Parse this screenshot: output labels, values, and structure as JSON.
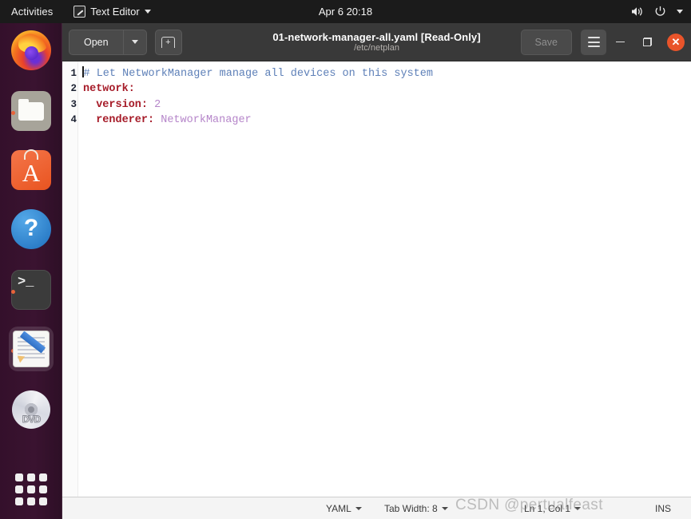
{
  "topbar": {
    "activities": "Activities",
    "app_menu": {
      "label": "Text Editor",
      "icon": "text-editor-icon",
      "arrow": "chevron-down-icon"
    },
    "clock": "Apr 6  20:18",
    "tray": [
      "volume-icon",
      "power-icon",
      "chevron-down-icon"
    ]
  },
  "dock": {
    "items": [
      {
        "name": "firefox",
        "label": "Firefox",
        "running": false,
        "active": false
      },
      {
        "name": "files",
        "label": "Files",
        "running": true,
        "active": false
      },
      {
        "name": "ubuntu-software",
        "label": "Ubuntu Software",
        "letter": "A",
        "running": false,
        "active": false
      },
      {
        "name": "help",
        "label": "Help",
        "glyph": "?",
        "running": false,
        "active": false
      },
      {
        "name": "terminal",
        "label": "Terminal",
        "glyph": ">_",
        "running": true,
        "active": false
      },
      {
        "name": "text-editor",
        "label": "Text Editor",
        "running": true,
        "active": true
      },
      {
        "name": "dvd-drive",
        "label": "DVD",
        "disc_label": "DVD",
        "running": false,
        "active": false
      },
      {
        "name": "show-applications",
        "label": "Show Applications",
        "running": false,
        "active": false
      }
    ]
  },
  "window": {
    "header": {
      "open_label": "Open",
      "open_arrow": "chevron-down-icon",
      "new_tab_icon": "new-tab-plus-icon",
      "title": "01-network-manager-all.yaml [Read-Only]",
      "subtitle": "/etc/netplan",
      "save_label": "Save",
      "menu_icon": "hamburger-menu-icon",
      "minimize_icon": "minimize-icon",
      "maximize_icon": "maximize-icon",
      "close_icon": "close-icon",
      "accent_close": "#e9542a"
    },
    "editor": {
      "line_numbers": [
        "1",
        "2",
        "3",
        "4"
      ],
      "lines": [
        {
          "n": 1,
          "tokens": [
            {
              "t": "comment",
              "s": "# Let NetworkManager manage all devices on this system"
            }
          ]
        },
        {
          "n": 2,
          "tokens": [
            {
              "t": "key",
              "s": "network"
            },
            {
              "t": "punct",
              "s": ":"
            }
          ]
        },
        {
          "n": 3,
          "tokens": [
            {
              "t": "plain",
              "s": "  "
            },
            {
              "t": "key",
              "s": "version"
            },
            {
              "t": "punct",
              "s": ":"
            },
            {
              "t": "plain",
              "s": " "
            },
            {
              "t": "val",
              "s": "2"
            }
          ]
        },
        {
          "n": 4,
          "tokens": [
            {
              "t": "plain",
              "s": "  "
            },
            {
              "t": "key",
              "s": "renderer"
            },
            {
              "t": "punct",
              "s": ":"
            },
            {
              "t": "plain",
              "s": " "
            },
            {
              "t": "val",
              "s": "NetworkManager"
            }
          ]
        }
      ],
      "colors": {
        "comment": "#5e80b8",
        "key": "#a61b28",
        "value": "#b585c9",
        "background": "#ffffff"
      }
    },
    "statusbar": {
      "language": "YAML",
      "language_arrow": "chevron-down-icon",
      "tab_width": "Tab Width: 8",
      "tab_width_arrow": "chevron-down-icon",
      "position": "Ln 1, Col 1",
      "position_arrow": "chevron-down-icon",
      "insert_mode": "INS"
    }
  },
  "watermark": "CSDN @pertualfeast"
}
